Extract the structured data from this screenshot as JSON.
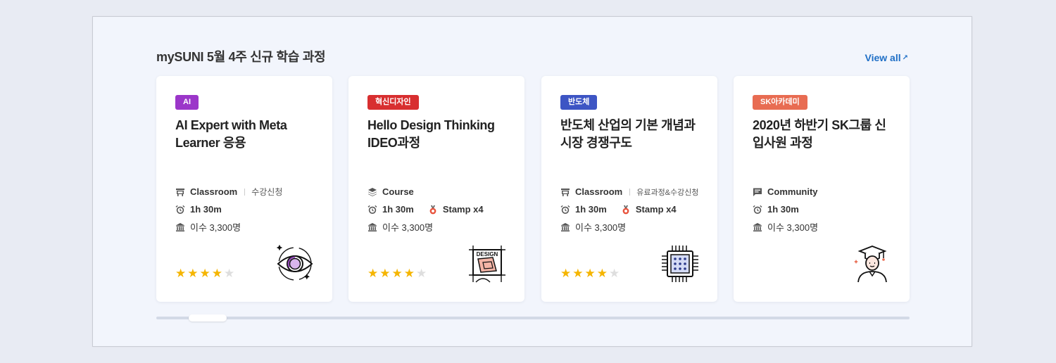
{
  "section": {
    "title": "mySUNI 5월 4주 신규 학습 과정",
    "view_all": "View all",
    "view_all_arrow": "↗"
  },
  "colors": {
    "accent": "#1f6fc6",
    "star_on": "#f5b500",
    "star_off": "#dedede",
    "badge_ai": "#9b36c9",
    "badge_design": "#d82f30",
    "badge_semi": "#3d55c4",
    "badge_sk": "#e86c52"
  },
  "cards": [
    {
      "category": "AI",
      "badge_color": "#9b36c9",
      "title": "AI Expert with Meta Learner 응용",
      "type_icon": "classroom-icon",
      "type": "Classroom",
      "type_note": "수강신청",
      "duration": "1h 30m",
      "stamp": "",
      "completion": "이수 3,300명",
      "rating": 4,
      "max_rating": 5,
      "illustration": "eye-icon"
    },
    {
      "category": "혁신디자인",
      "badge_color": "#d82f30",
      "title": "Hello Design Thinking IDEO과정",
      "type_icon": "course-stack-icon",
      "type": "Course",
      "type_note": "",
      "duration": "1h 30m",
      "stamp": "Stamp x4",
      "completion": "이수 3,300명",
      "rating": 4,
      "max_rating": 5,
      "illustration": "design-board-icon",
      "illustration_text": "DESIGN"
    },
    {
      "category": "반도체",
      "badge_color": "#3d55c4",
      "title": "반도체 산업의 기본 개념과 시장 경쟁구도",
      "type_icon": "classroom-icon",
      "type": "Classroom",
      "type_note": "유료과정&수강신청",
      "duration": "1h 30m",
      "stamp": "Stamp x4",
      "completion": "이수 3,300명",
      "rating": 4,
      "max_rating": 5,
      "illustration": "chip-icon"
    },
    {
      "category": "SK아카데미",
      "badge_color": "#e86c52",
      "title": "2020년 하반기 SK그룹 신입사원 과정",
      "type_icon": "community-icon",
      "type": "Community",
      "type_note": "",
      "duration": "1h 30m",
      "stamp": "",
      "completion": "이수 3,300명",
      "rating": 0,
      "max_rating": 0,
      "illustration": "graduate-icon"
    }
  ],
  "scrollbar": {
    "position_fraction": 0.045
  }
}
